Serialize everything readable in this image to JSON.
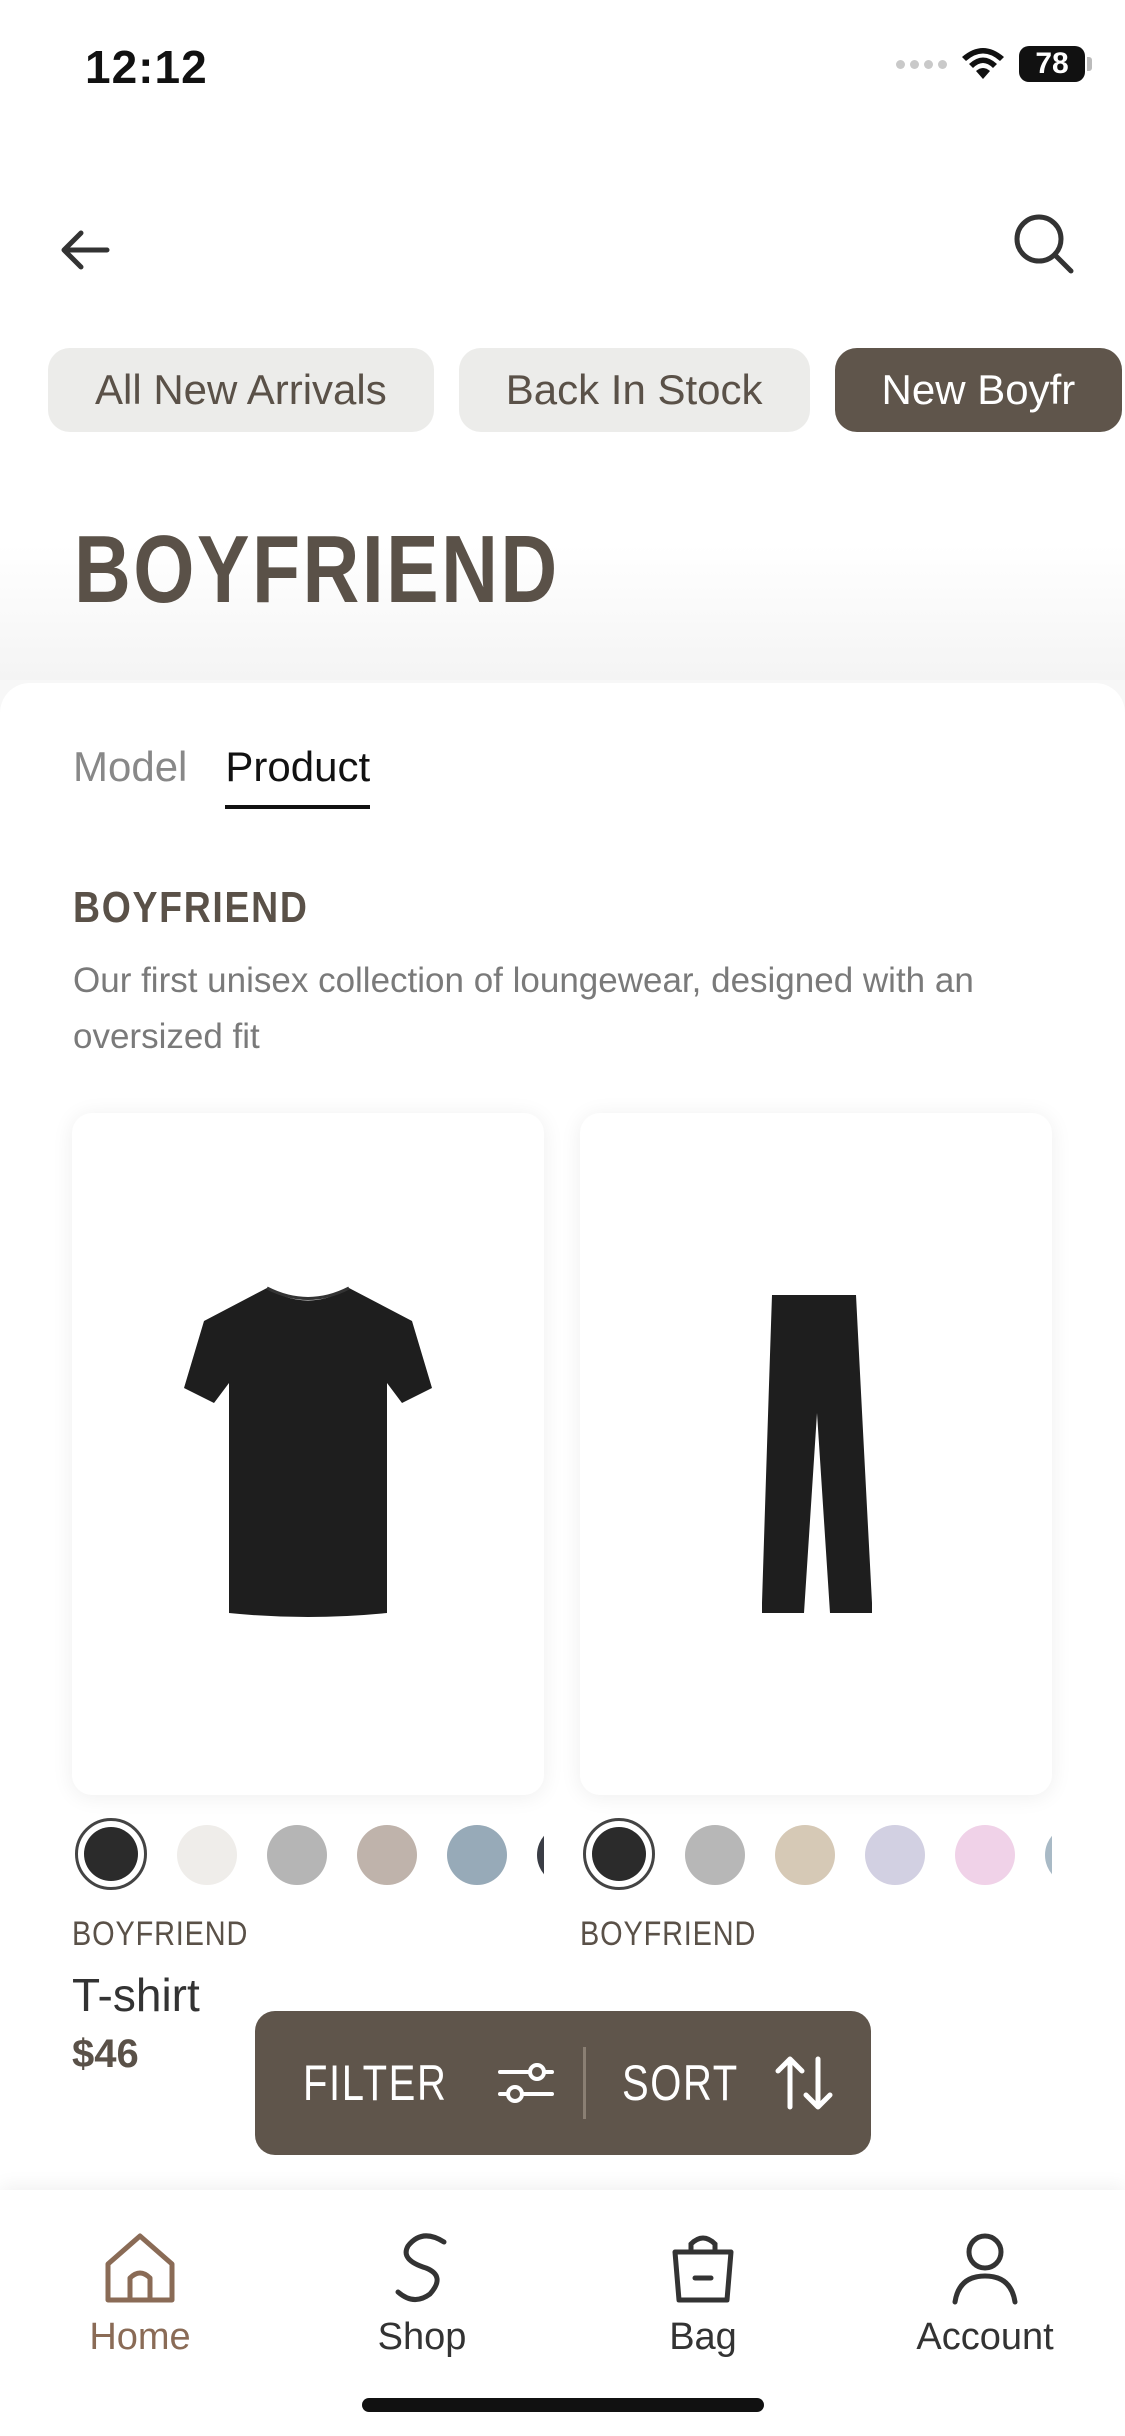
{
  "status_bar": {
    "time": "12:12",
    "battery": "78"
  },
  "chips": [
    {
      "label": "All New Arrivals",
      "active": false
    },
    {
      "label": "Back In Stock",
      "active": false
    },
    {
      "label": "New Boyfr",
      "active": true
    }
  ],
  "page": {
    "title": "BOYFRIEND"
  },
  "tabs": [
    {
      "label": "Model",
      "active": false
    },
    {
      "label": "Product",
      "active": true
    }
  ],
  "collection": {
    "title": "BOYFRIEND",
    "description": "Our first unisex collection of loungewear, designed with an oversized fit"
  },
  "products": [
    {
      "brand": "BOYFRIEND",
      "name": "T-shirt",
      "price": "$46",
      "swatches": [
        "#2b2b2b",
        "#efedea",
        "#b5b5b5",
        "#bfb3ab",
        "#97aab8",
        "#3a3d45"
      ]
    },
    {
      "brand": "BOYFRIEND",
      "name": "",
      "price": "",
      "swatches": [
        "#2b2b2b",
        "#b7b7b7",
        "#d6c9b6",
        "#d2d0e2",
        "#f0d2e8",
        "#a9bac6"
      ]
    }
  ],
  "filter_bar": {
    "filter_label": "FILTER",
    "sort_label": "SORT"
  },
  "bottom_nav": [
    {
      "label": "Home",
      "icon": "home-icon",
      "active": true
    },
    {
      "label": "Shop",
      "icon": "shop-icon",
      "active": false
    },
    {
      "label": "Bag",
      "icon": "bag-icon",
      "active": false
    },
    {
      "label": "Account",
      "icon": "account-icon",
      "active": false
    }
  ],
  "colors": {
    "accent": "#5f554b",
    "active_nav": "#8a6b56",
    "chip_bg": "#ececea"
  }
}
